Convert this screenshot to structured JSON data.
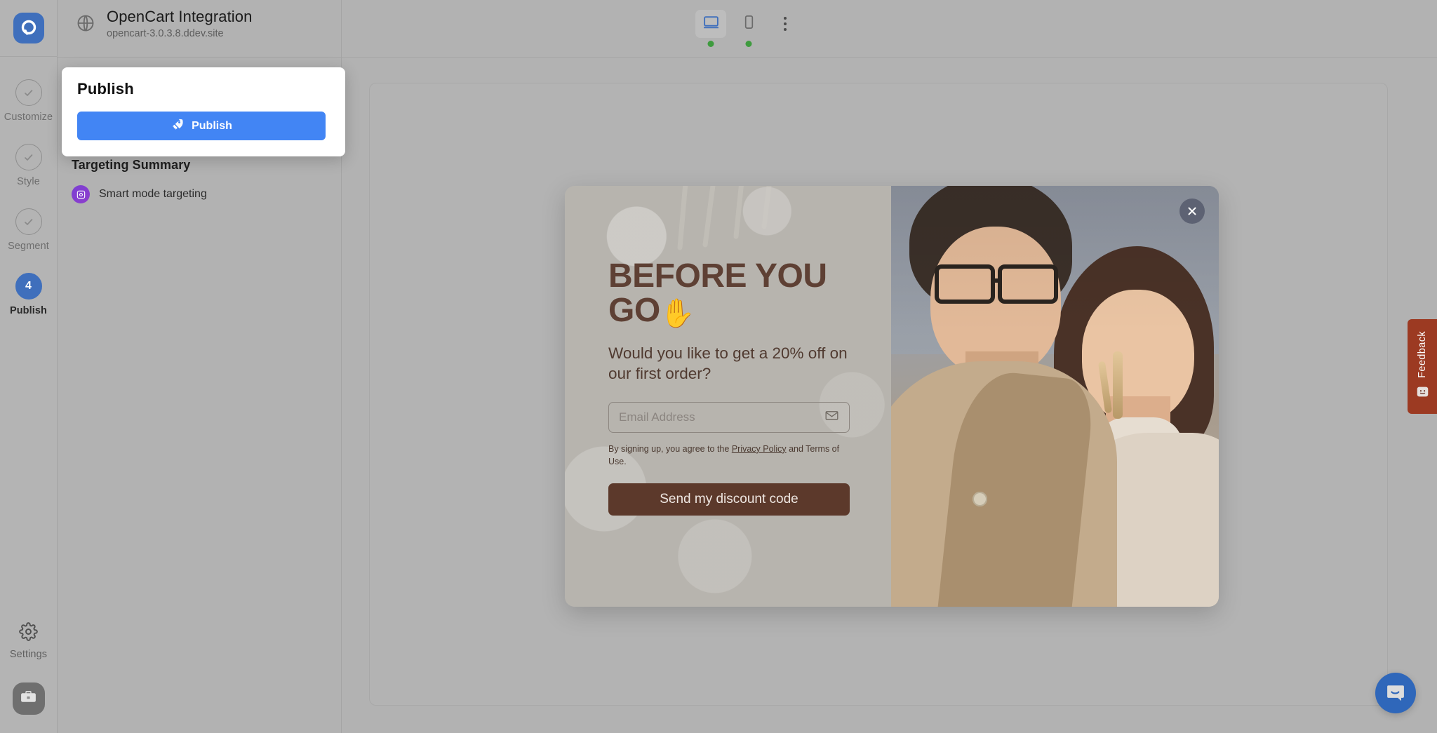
{
  "rail": {
    "logo_icon": "popupsmart-logo-icon",
    "steps": [
      {
        "label": "Customize",
        "state": "completed",
        "icon": "check-icon"
      },
      {
        "label": "Style",
        "state": "completed",
        "icon": "check-icon"
      },
      {
        "label": "Segment",
        "state": "completed",
        "icon": "check-icon"
      },
      {
        "label": "Publish",
        "state": "active",
        "badge": "4"
      }
    ],
    "settings_label": "Settings",
    "settings_icon": "gear-icon",
    "avatar_icon": "briefcase-icon"
  },
  "topbar": {
    "site_name": "OpenCart Integration",
    "site_url": "opencart-3.0.3.8.ddev.site",
    "globe_icon": "globe-icon",
    "devices": [
      {
        "name": "desktop",
        "icon": "desktop-icon",
        "active": true,
        "status_dot": "#3e9b3e"
      },
      {
        "name": "mobile",
        "icon": "mobile-icon",
        "active": false,
        "status_dot": "#3e9b3e"
      }
    ],
    "more_icon": "kebab-menu-icon"
  },
  "publish_popover": {
    "title": "Publish",
    "button_label": "Publish",
    "button_icon": "rocket-icon",
    "button_color": "#4285f4"
  },
  "targeting": {
    "title": "Targeting Summary",
    "item_label": "Smart mode targeting",
    "item_icon": "smart-target-icon",
    "item_color": "#7b3fd4"
  },
  "popup_preview": {
    "headline_line1": "BEFORE YOU",
    "headline_line2": "GO",
    "headline_emoji": "✋",
    "subheadline": "Would you like to get a 20% off on our first order?",
    "email_placeholder": "Email Address",
    "email_value": "",
    "email_icon": "envelope-icon",
    "legal_prefix": "By signing up, you agree to the ",
    "legal_link": "Privacy Policy",
    "legal_suffix": " and Terms of Use.",
    "cta_label": "Send my discount code",
    "cta_color": "#5c392b",
    "headline_color": "#5e4034",
    "close_icon": "close-icon"
  },
  "feedback": {
    "label": "Feedback",
    "icon": "smiley-icon",
    "color": "#9c3a22"
  },
  "intercom": {
    "icon": "chat-bubble-icon",
    "color": "#2f67ba"
  }
}
